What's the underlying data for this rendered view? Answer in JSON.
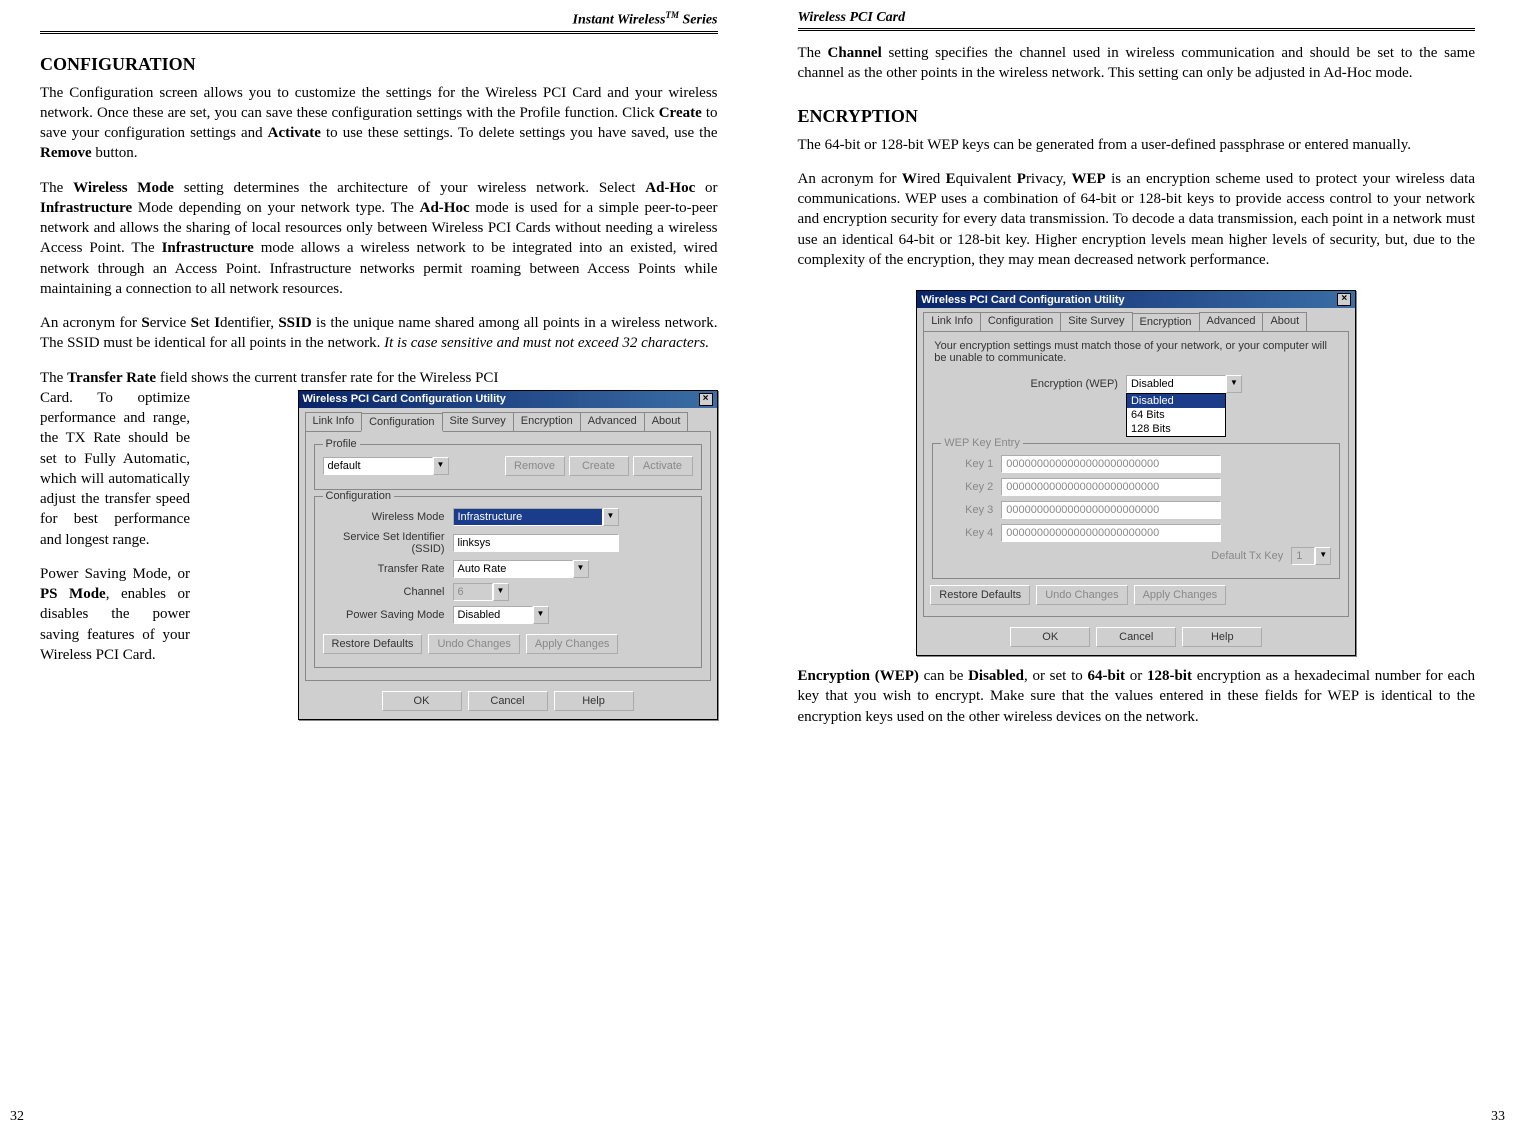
{
  "left": {
    "header": "Instant Wireless",
    "header_tm": "TM",
    "header_suffix": " Series",
    "section_title": "CONFIGURATION",
    "p1_a": "The Configuration screen allows you to customize the settings for the Wireless PCI Card and your wireless network. Once these are set, you can save these configuration settings with the Profile function. Click ",
    "p1_b1": "Create",
    "p1_c": " to save your configuration settings and ",
    "p1_b2": "Activate",
    "p1_d": " to use these settings. To delete settings you have saved, use the ",
    "p1_b3": "Remove",
    "p1_e": " button.",
    "p2_a": "The ",
    "p2_b1": "Wireless Mode",
    "p2_c": " setting determines the architecture of your wireless network. Select ",
    "p2_b2": "Ad-Hoc",
    "p2_d": " or ",
    "p2_b3": "Infrastructure",
    "p2_e": " Mode depending on your network type. The ",
    "p2_b4": "Ad-Hoc",
    "p2_f": " mode is used for a simple peer-to-peer network and allows the sharing of local resources only between Wireless PCI Cards without needing a wireless Access Point. The ",
    "p2_b5": "Infrastructure",
    "p2_g": " mode allows a wireless network to be integrated into an existed, wired network through an Access Point. Infrastructure networks permit roaming between Access Points while maintaining a connection to all network resources.",
    "p3_a": "An acronym for ",
    "p3_b1": "S",
    "p3_c": "ervice ",
    "p3_b2": "S",
    "p3_d": "et ",
    "p3_b3": "I",
    "p3_e": "dentifier, ",
    "p3_b4": "SSID",
    "p3_f": " is the unique name shared among all points in a wireless network. The SSID must be identical for all points in the network. ",
    "p3_i": "It is case sensitive and must not exceed 32 characters.",
    "p4_a": "The ",
    "p4_b1": "Transfer  Rate",
    "p4_c": " field shows the current transfer rate for the Wireless PCI",
    "narrow1": "Card. To optimize performance and range, the TX Rate should be set to Fully Automatic, which will automatically adjust the transfer speed for best performance and longest range.",
    "narrow2_a": "Power Saving Mode, or ",
    "narrow2_b": "PS Mode",
    "narrow2_c": ", enables or disables the power saving features of your Wireless PCI Card.",
    "pagenum": "32"
  },
  "right": {
    "header": "Wireless PCI Card",
    "p1_a": "The ",
    "p1_b": "Channel",
    "p1_c": " setting specifies the channel used in wireless communication and should be set to the same channel as the other points in the wireless network. This setting can only be adjusted in Ad-Hoc mode.",
    "section_title": "ENCRYPTION",
    "p2": "The 64-bit or 128-bit WEP keys can be generated from a user-defined passphrase or entered manually.",
    "p3_a": "An acronym for ",
    "p3_b1": "W",
    "p3_c": "ired ",
    "p3_b2": "E",
    "p3_d": "quivalent ",
    "p3_b3": "P",
    "p3_e": "rivacy, ",
    "p3_b4": "WEP",
    "p3_f": " is an encryption scheme used to protect your wireless data communications. WEP uses a combination of 64-bit or 128-bit keys to provide access control to your network and encryption security for every data transmission. To decode a data transmission, each point in a network must use an identical 64-bit or 128-bit key.   Higher encryption levels mean higher levels of security, but, due to the complexity of the encryption, they may mean decreased network performance.",
    "p4_a": "Encryption (WEP)",
    "p4_b": " can be ",
    "p4_c": "Disabled",
    "p4_d": ", or set to ",
    "p4_e": "64-bit",
    "p4_f": " or ",
    "p4_g": "128-bit",
    "p4_h": " encryption as a hexadecimal number for each key that you wish to encrypt.  Make sure that the values entered in these fields for WEP is identical to the encryption keys used on the other wireless devices on the network.",
    "pagenum": "33"
  },
  "dialog1": {
    "title": "Wireless PCI Card Configuration Utility",
    "tabs": [
      "Link Info",
      "Configuration",
      "Site Survey",
      "Encryption",
      "Advanced",
      "About"
    ],
    "active_tab": 1,
    "profile_label": "Profile",
    "profile_value": "default",
    "btn_remove": "Remove",
    "btn_create": "Create",
    "btn_activate": "Activate",
    "config_label": "Configuration",
    "lbl_mode": "Wireless Mode",
    "val_mode": "Infrastructure",
    "lbl_ssid": "Service Set Identifier (SSID)",
    "val_ssid": "linksys",
    "lbl_rate": "Transfer Rate",
    "val_rate": "Auto Rate",
    "lbl_channel": "Channel",
    "val_channel": "6",
    "lbl_ps": "Power Saving Mode",
    "val_ps": "Disabled",
    "btn_restore": "Restore Defaults",
    "btn_undo": "Undo Changes",
    "btn_apply": "Apply Changes",
    "btn_ok": "OK",
    "btn_cancel": "Cancel",
    "btn_help": "Help"
  },
  "dialog2": {
    "title": "Wireless PCI Card Configuration Utility",
    "tabs": [
      "Link Info",
      "Configuration",
      "Site Survey",
      "Encryption",
      "Advanced",
      "About"
    ],
    "active_tab": 3,
    "subtext": "Your encryption settings must match those of your network, or your computer will be unable to communicate.",
    "lbl_enc": "Encryption (WEP)",
    "val_enc": "Disabled",
    "dd_opt1": "Disabled",
    "dd_opt2": "64 Bits",
    "dd_opt3": "128 Bits",
    "wep_label": "WEP Key Entry",
    "key_lbl1": "Key 1",
    "key_lbl2": "Key 2",
    "key_lbl3": "Key 3",
    "key_lbl4": "Key 4",
    "key_val": "0000000000000000000000000",
    "lbl_defkey": "Default Tx Key",
    "val_defkey": "1",
    "btn_restore": "Restore Defaults",
    "btn_undo": "Undo Changes",
    "btn_apply": "Apply Changes",
    "btn_ok": "OK",
    "btn_cancel": "Cancel",
    "btn_help": "Help"
  }
}
